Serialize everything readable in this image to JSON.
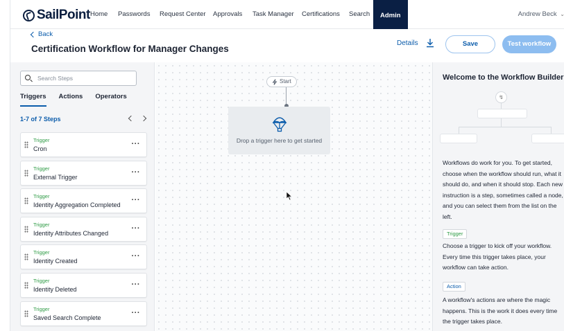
{
  "nav": {
    "logo": "SailPoint",
    "items": [
      "Home",
      "Passwords",
      "Request Center",
      "Approvals",
      "Task Manager",
      "Certifications",
      "Search"
    ],
    "active": "Admin",
    "user": "Andrew Beck"
  },
  "header": {
    "back": "Back",
    "title": "Certification Workflow for Manager Changes",
    "details": "Details",
    "save": "Save",
    "test": "Test workflow"
  },
  "left": {
    "search_placeholder": "Search Steps",
    "tabs": [
      "Triggers",
      "Actions",
      "Operators"
    ],
    "count": "1-7 of 7 Steps",
    "steps": [
      {
        "type": "Trigger",
        "name": "Cron"
      },
      {
        "type": "Trigger",
        "name": "External Trigger"
      },
      {
        "type": "Trigger",
        "name": "Identity Aggregation Completed"
      },
      {
        "type": "Trigger",
        "name": "Identity Attributes Changed"
      },
      {
        "type": "Trigger",
        "name": "Identity Created"
      },
      {
        "type": "Trigger",
        "name": "Identity Deleted"
      },
      {
        "type": "Trigger",
        "name": "Saved Search Complete"
      }
    ],
    "more": "···"
  },
  "canvas": {
    "start": "Start",
    "drop_text": "Drop a trigger here to get started"
  },
  "right": {
    "welcome": "Welcome to the Workflow Builder",
    "intro": "Workflows do work for you. To get started, choose when the workflow should run, what it should do, and when it should stop. Each new instruction is a step, sometimes called a node, and you can select them from the list on the left.",
    "trigger_tag": "Trigger",
    "trigger_text": "Choose a trigger to kick off your workflow. Every time this trigger takes place, your workflow can take action.",
    "action_tag": "Action",
    "action_text": "A workflow's actions are where the magic happens. This is the work it does every time the trigger takes place."
  },
  "colors": {
    "brand": "#0a1f44",
    "accent": "#0b5cab",
    "trigger_green": "#2e9b45"
  }
}
